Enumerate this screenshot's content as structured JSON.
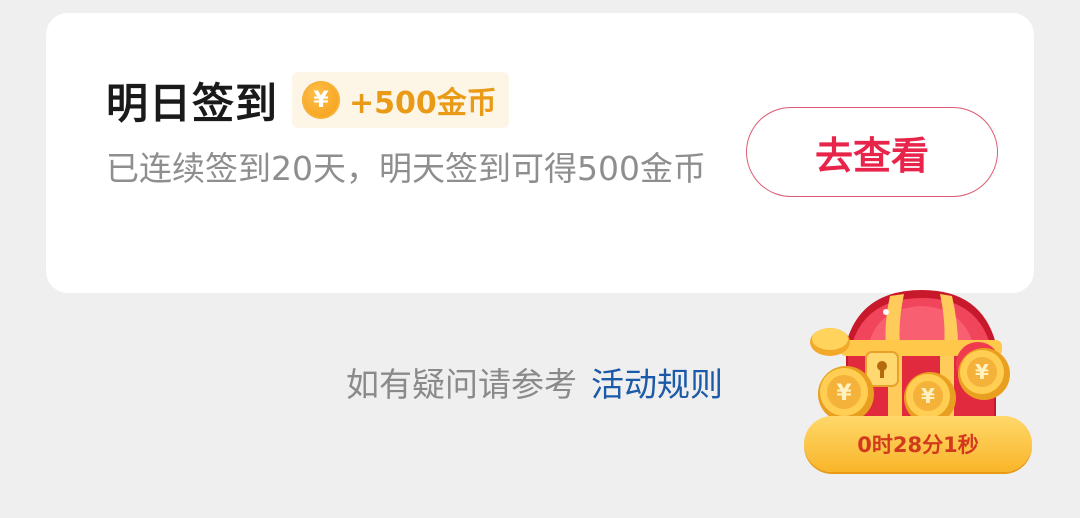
{
  "card": {
    "title": "明日签到",
    "reward_symbol": "¥",
    "reward_text": "+500金币",
    "description": "已连续签到20天，明天签到可得500金币",
    "view_button": "去查看"
  },
  "help": {
    "text": "如有疑问请参考",
    "link": "活动规则"
  },
  "chest": {
    "coin_symbol": "¥",
    "countdown": "0时28分1秒"
  },
  "colors": {
    "accent_red": "#e8244a",
    "gold": "#e99b18",
    "link_blue": "#1b5aa8"
  }
}
